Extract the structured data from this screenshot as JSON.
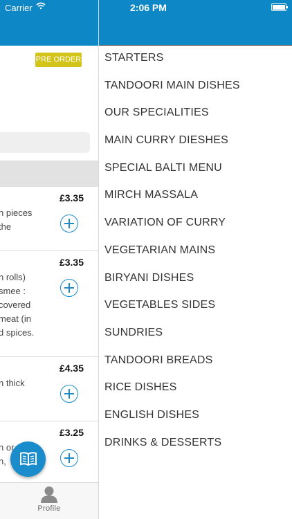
{
  "status_bar": {
    "carrier": "Carrier",
    "time": "2:06 PM"
  },
  "colors": {
    "primary": "#0e87c7",
    "accent_button": "#1a8bcb",
    "preorder_badge": "#d2c418"
  },
  "restaurant": {
    "preorder_label": "PRE ORDER"
  },
  "items": [
    {
      "price": "£3.35",
      "desc": "n pieces\nthe"
    },
    {
      "price": "£3.35",
      "desc": "n rolls)\nsmee :\ncovered\nmeat (in\nd spices."
    },
    {
      "price": "£4.35",
      "desc": "n thick"
    },
    {
      "price": "£3.25",
      "desc": "n or\nn,"
    }
  ],
  "tabbar": {
    "profile_label": "Profile"
  },
  "icons": {
    "menu_fab": "book-icon",
    "profile_tab": "person-icon",
    "add": "plus-circle-icon"
  },
  "categories": [
    "STARTERS",
    "TANDOORI MAIN DISHES",
    "OUR SPECIALITIES",
    "MAIN CURRY DIESHES",
    "SPECIAL BALTI MENU",
    "MIRCH MASSALA",
    "VARIATION OF CURRY",
    "VEGETARIAN MAINS",
    "BIRYANI DISHES",
    "VEGETABLES SIDES",
    "SUNDRIES",
    "TANDOORI BREADS",
    "RICE DISHES",
    "ENGLISH DISHES",
    "DRINKS & DESSERTS"
  ]
}
